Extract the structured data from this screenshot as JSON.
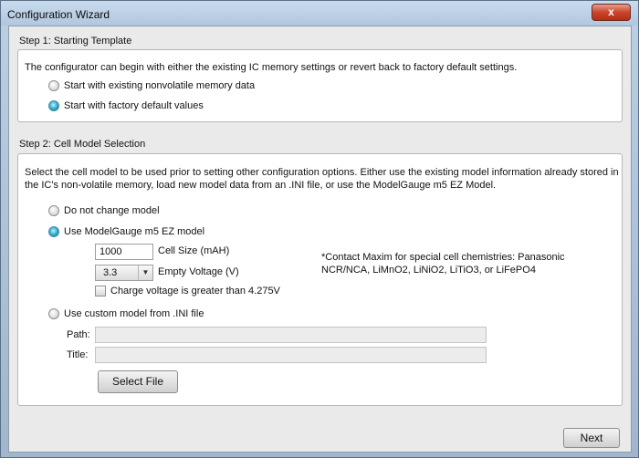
{
  "window": {
    "title": "Configuration Wizard",
    "close_label": "x"
  },
  "step1": {
    "title": "Step 1: Starting Template",
    "description": "The configurator can begin with either the existing IC memory settings or revert back to factory default settings.",
    "options": [
      {
        "label": "Start with existing nonvolatile memory data",
        "selected": false
      },
      {
        "label": "Start with factory default values",
        "selected": true
      }
    ]
  },
  "step2": {
    "title": "Step 2: Cell Model Selection",
    "description": "Select the cell model to be used prior to setting other configuration options. Either use the existing model information already stored in the IC's non-volatile memory, load new model data from an .INI file, or use the ModelGauge m5 EZ Model.",
    "options": {
      "no_change": {
        "label": "Do not change model",
        "selected": false
      },
      "ez_model": {
        "label": "Use ModelGauge m5 EZ model",
        "selected": true
      },
      "custom": {
        "label": "Use custom model from .INI file",
        "selected": false
      }
    },
    "cell_size": {
      "value": "1000",
      "label": "Cell Size (mAH)"
    },
    "empty_voltage": {
      "value": "3.3",
      "label": "Empty Voltage (V)"
    },
    "charge_voltage": {
      "label": "Charge voltage is greater than 4.275V",
      "checked": false
    },
    "note": "*Contact Maxim for special cell chemistries: Panasonic NCR/NCA, LiMnO2, LiNiO2, LiTiO3, or LiFePO4",
    "path": {
      "label": "Path:",
      "value": ""
    },
    "title_field": {
      "label": "Title:",
      "value": ""
    },
    "select_file_label": "Select File"
  },
  "footer": {
    "next_label": "Next"
  }
}
